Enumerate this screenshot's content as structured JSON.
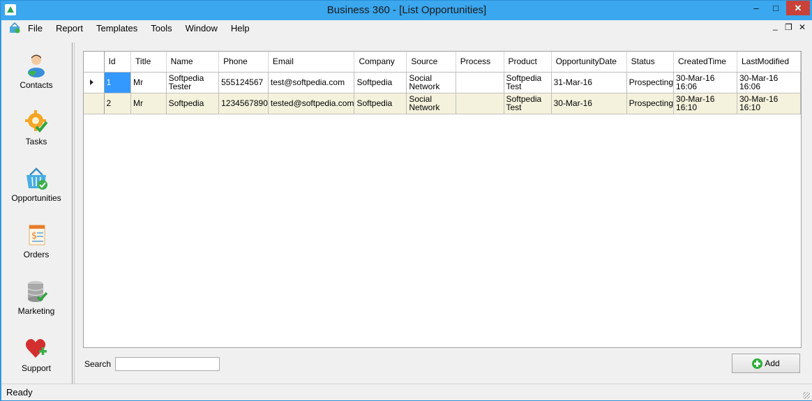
{
  "window": {
    "title": "Business 360 - [List Opportunities]",
    "minimize": "–",
    "maximize": "□",
    "close": "✕"
  },
  "menu": {
    "items": [
      "File",
      "Report",
      "Templates",
      "Tools",
      "Window",
      "Help"
    ],
    "mdi_minimize": "_",
    "mdi_restore": "❐",
    "mdi_close": "✕"
  },
  "nav": {
    "items": [
      {
        "label": "Contacts",
        "icon": "contacts-icon"
      },
      {
        "label": "Tasks",
        "icon": "tasks-icon"
      },
      {
        "label": "Opportunities",
        "icon": "basket-icon"
      },
      {
        "label": "Orders",
        "icon": "orders-icon"
      },
      {
        "label": "Marketing",
        "icon": "database-icon"
      },
      {
        "label": "Support",
        "icon": "heart-plus-icon"
      }
    ]
  },
  "grid": {
    "columns": [
      "Id",
      "Title",
      "Name",
      "Phone",
      "Email",
      "Company",
      "Source",
      "Process",
      "Product",
      "OpportunityDate",
      "Status",
      "CreatedTime",
      "LastModified"
    ],
    "rows": [
      [
        "1",
        "Mr",
        "Softpedia Tester",
        "555124567",
        "test@softpedia.com",
        "Softpedia",
        "Social Network",
        "",
        "Softpedia Test",
        "31-Mar-16",
        "Prospecting",
        "30-Mar-16 16:06",
        "30-Mar-16 16:06"
      ],
      [
        "2",
        "Mr",
        "Softpedia",
        "1234567890",
        "tested@softpedia.com",
        "Softpedia",
        "Social Network",
        "",
        "Softpedia Test",
        "30-Mar-16",
        "Prospecting",
        "30-Mar-16 16:10",
        "30-Mar-16 16:10"
      ]
    ]
  },
  "search": {
    "label": "Search",
    "value": ""
  },
  "add_button": {
    "label": "Add"
  },
  "status": {
    "text": "Ready"
  },
  "colors": {
    "titlebar": "#3aa7ee",
    "selection": "#3399ff",
    "alt_row": "#f4f2dc",
    "close": "#c9423a"
  }
}
